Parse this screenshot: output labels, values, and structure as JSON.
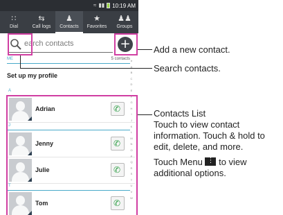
{
  "status_bar": {
    "time": "10:19 AM"
  },
  "tabs": [
    {
      "label": "Dial",
      "icon": "dialpad-icon",
      "active": false
    },
    {
      "label": "Call logs",
      "icon": "call-logs-icon",
      "active": false
    },
    {
      "label": "Contacts",
      "icon": "contacts-icon",
      "active": true
    },
    {
      "label": "Favorites",
      "icon": "star-icon",
      "active": false
    },
    {
      "label": "Groups",
      "icon": "groups-icon",
      "active": false
    }
  ],
  "search": {
    "text": "earch contacts"
  },
  "me_section": {
    "label": "ME",
    "count": "5 contacts"
  },
  "profile": {
    "label": "Set up my profile"
  },
  "contacts": [
    {
      "section": "A",
      "name": "Adrian"
    },
    {
      "section": "J",
      "name": "Jenny"
    },
    {
      "section": "",
      "name": "Julie"
    },
    {
      "section": "T",
      "name": "Tom"
    }
  ],
  "alpha_index": [
    "#",
    "A",
    "B",
    "C",
    "D",
    "E",
    "F",
    "G",
    "H",
    "I",
    "J",
    "K",
    "L",
    "M",
    "N",
    "O",
    "P",
    "Q",
    "R",
    "S",
    "T",
    "U",
    "V",
    "W"
  ],
  "callouts": {
    "add": "Add a new contact.",
    "search": "Search contacts.",
    "list_title": "Contacts List",
    "list_body": "Touch to view contact information. Touch & hold to edit, delete, and more.",
    "menu_before": "Touch Menu",
    "menu_after": "to view additional options."
  },
  "colors": {
    "highlight": "#d03ea2",
    "call_green": "#2e9e45",
    "section_blue": "#48a9c9",
    "tab_bg": "#3a3e44"
  }
}
